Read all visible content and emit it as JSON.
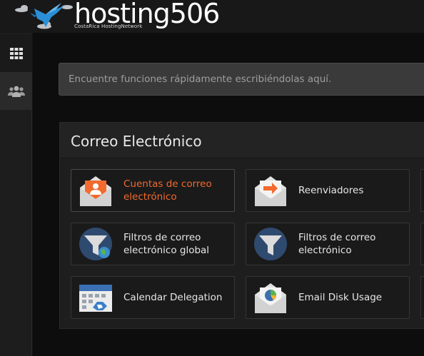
{
  "header": {
    "brand": "hosting506",
    "tagline": "CostaRica HostingNetwork"
  },
  "sidebar": {
    "items": [
      {
        "icon": "grid-icon"
      },
      {
        "icon": "users-icon"
      }
    ]
  },
  "search": {
    "placeholder": "Encuentre funciones rápidamente escribiéndolas aquí."
  },
  "section": {
    "title": "Correo Electrónico",
    "tiles": [
      {
        "label_line1": "Cuentas de correo",
        "label_line2": "electrónico",
        "icon": "email-account-icon",
        "active": true
      },
      {
        "label_line1": "Reenviadores",
        "label_line2": "",
        "icon": "forwarder-icon",
        "active": false
      },
      {
        "label_line1": "Filtros de correo",
        "label_line2": "electrónico global",
        "icon": "global-filter-icon",
        "active": false
      },
      {
        "label_line1": "Filtros de correo",
        "label_line2": "electrónico",
        "icon": "filter-icon",
        "active": false
      },
      {
        "label_line1": "Calendar Delegation",
        "label_line2": "",
        "icon": "calendar-icon",
        "active": false
      },
      {
        "label_line1": "Email Disk Usage",
        "label_line2": "",
        "icon": "disk-usage-icon",
        "active": false
      }
    ]
  },
  "colors": {
    "accent": "#f26a2e",
    "bird": "#2a8fd6",
    "envelope": "#e8e8e8",
    "filter_circle": "#2f4a6f",
    "calendar_blue": "#3b6fb3"
  }
}
